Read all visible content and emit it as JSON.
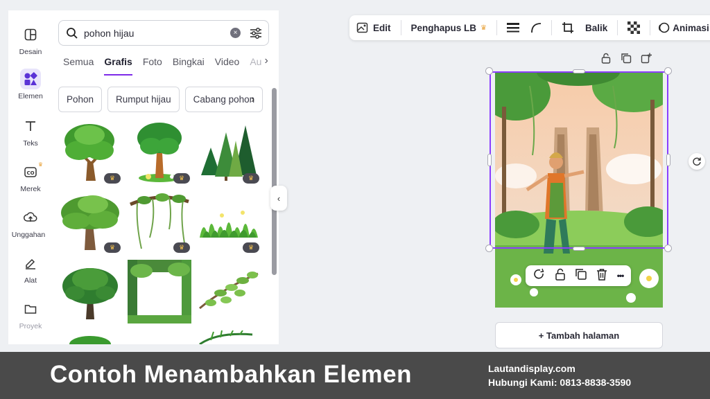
{
  "rail": {
    "items": [
      {
        "label": "Desain",
        "icon": "layout-icon"
      },
      {
        "label": "Elemen",
        "icon": "elements-icon"
      },
      {
        "label": "Teks",
        "icon": "text-icon"
      },
      {
        "label": "Merek",
        "icon": "brand-icon"
      },
      {
        "label": "Unggahan",
        "icon": "upload-icon"
      },
      {
        "label": "Alat",
        "icon": "draw-icon"
      },
      {
        "label": "Proyek",
        "icon": "folder-icon"
      }
    ]
  },
  "search": {
    "value": "pohon hijau",
    "clear_label": "×"
  },
  "tabs": {
    "items": [
      "Semua",
      "Grafis",
      "Foto",
      "Bingkai",
      "Video",
      "Au"
    ],
    "active": "Grafis",
    "next": "›"
  },
  "chips": {
    "items": [
      "Pohon",
      "Rumput hijau",
      "Cabang pohon"
    ],
    "next": "›"
  },
  "results": {
    "crown_glyph": "♛"
  },
  "collapse": {
    "label": "‹"
  },
  "toolbar": {
    "edit_label": "Edit",
    "bg_remover_label": "Penghapus LB",
    "flip_label": "Balik",
    "animate_label": "Animasi"
  },
  "context_menu": {
    "more_label": "•••"
  },
  "add_page": {
    "label": "+ Tambah halaman"
  },
  "banner": {
    "title": "Contoh Menambahkan Elemen",
    "site": "Lautandisplay.com",
    "contact": "Hubungi Kami:  0813-8838-3590"
  },
  "colors": {
    "accent": "#7d2ae8",
    "selection": "#8b3dff",
    "premium_crown": "#e8a33d",
    "banner_bg": "#4a4a4a"
  }
}
